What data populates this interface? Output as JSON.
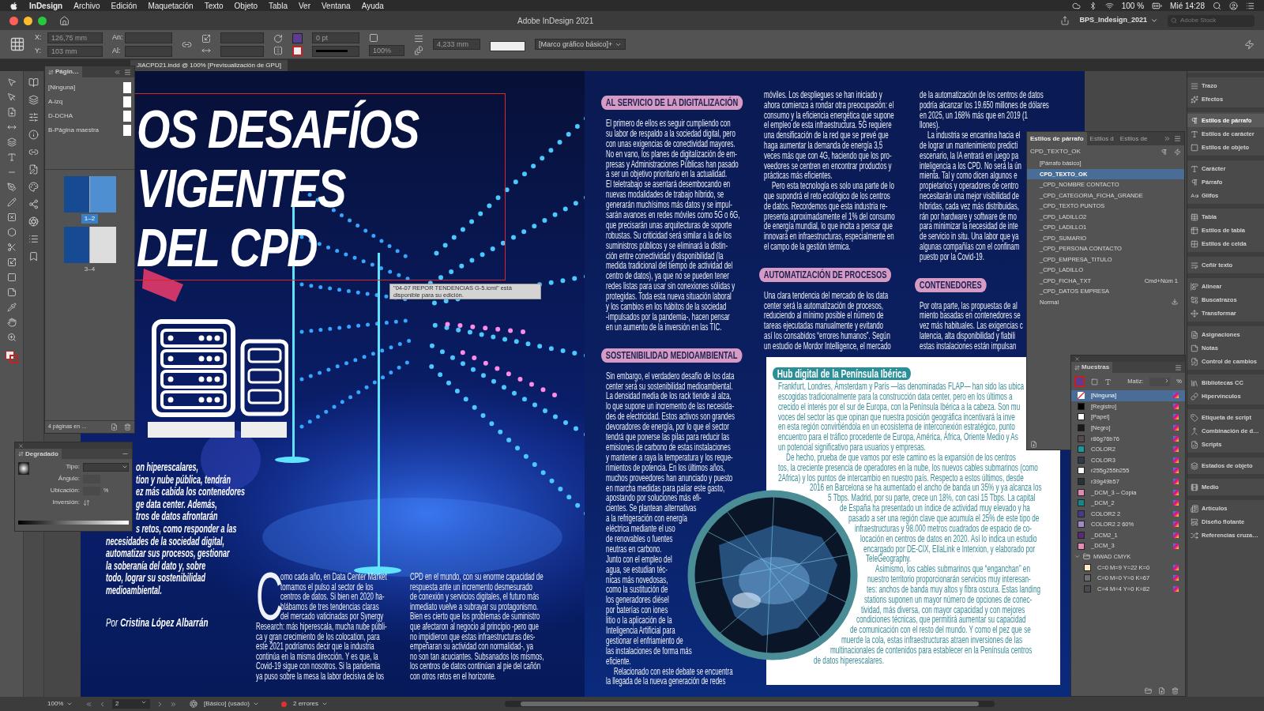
{
  "menu_bar": {
    "app": "InDesign",
    "items": [
      "Archivo",
      "Edición",
      "Maquetación",
      "Texto",
      "Objeto",
      "Tabla",
      "Ver",
      "Ventana",
      "Ayuda"
    ],
    "battery": "100 %",
    "clock": "Mié 14:28"
  },
  "title_bar": {
    "title": "Adobe InDesign 2021",
    "workspace": "BPS_Indesign_2021",
    "stock_search": {
      "placeholder": "Adobe Stock"
    }
  },
  "control_bar": {
    "x_label": "X:",
    "x": "126,75 mm",
    "y_label": "Y:",
    "y": "103 mm",
    "width_label": "An:",
    "height_label": "Al:",
    "stroke_weight": "0 pt",
    "scale": "100%",
    "offset": "4,233 mm",
    "object_style": "[Marco gráfico básico]+"
  },
  "document_tab": {
    "title": "JIACPD21.indd @ 100% [Previsualización de GPU]"
  },
  "pages_panel": {
    "title": "Págin…",
    "masters": [
      {
        "label": "[Ninguna]"
      },
      {
        "label": "A-izq"
      },
      {
        "label": "D-DCHA"
      },
      {
        "label": "B-Página maestra"
      }
    ],
    "spreads": [
      {
        "label": "1–2",
        "selected": true
      },
      {
        "label": "3–4",
        "selected": false
      }
    ],
    "footer": "4 páginas en …"
  },
  "gradient_panel": {
    "title": "Degradado",
    "type_label": "Tipo:",
    "angle_label": "Ángulo:",
    "location_label": "Ubicación:",
    "location_unit": "%",
    "reverse_label": "Inversión:"
  },
  "spread": {
    "title_lines": [
      "OS DESAFÍOS",
      "VIGENTES",
      "DEL CPD"
    ],
    "tooltip": "\"04-07 REPOR TENDENCIAS G-5.icml\" está disponible para su edición.",
    "intro_lines": [
      "on hiperescalares,",
      "tion y nube pública, tendrán",
      "ez más cabida los contenedores",
      "ge data center. Además,",
      "tros de datos afrontarán",
      "s retos, como responder a las",
      "necesidades de la sociedad digital,",
      "automatizar sus procesos, gestionar",
      "la soberanía del dato y, sobre",
      "todo, lograr su sostenibilidad",
      "medioambiental."
    ],
    "byline": "Por **Cristina López Albarrán**",
    "columns": [
      {
        "blocks": [
          {
            "kind": "paragraph",
            "drop_cap": "C",
            "lines": [
              "omo cada año, en Data Center Market",
              "tomamos el pulso al sector de los",
              "centros de datos. Si bien en 2020 ha-",
              "blábamos de tres tendencias claras",
              "del mercado vaticinadas por Synergy",
              "Research: más hiperescala, mucha nube públi-",
              "ca y gran crecimiento de los colocation, para",
              "este 2021 podríamos decir que la industria",
              "continúa en la misma dirección. Y es que, la",
              "Covid-19 sigue con nosotros. Si la pandemia",
              "ya puso sobre la mesa la labor decisiva de los"
            ]
          }
        ]
      },
      {
        "blocks": [
          {
            "kind": "paragraph",
            "lines": [
              "CPD en el mundo, con su enorme capacidad de",
              "respuesta ante un incremento desmesurado",
              "de conexión y servicios digitales, el futuro más",
              "inmediato vuelve a subrayar su protagonismo.",
              "Bien es cierto que los problemas de suministro",
              "que afectaron al negocio al principio -pero que",
              "no impidieron que estas infraestructuras des-",
              "empeñaran su actividad con normalidad-, ya",
              "no son tan acuciantes. Subsanados los mismos,",
              "los centros de datos continúan al pie del cañón",
              "con otros retos en el horizonte."
            ]
          }
        ]
      },
      {
        "blocks": [
          {
            "kind": "heading",
            "text": "AL SERVICIO DE LA DIGITALIZACIÓN"
          },
          {
            "kind": "paragraph",
            "lines": [
              "El primero de ellos es seguir cumpliendo con",
              "su labor de respaldo a la sociedad digital, pero",
              "con unas exigencias de conectividad mayores.",
              "No en vano, los planes de digitalización de em-",
              "presas y Administraciones Públicas han pasado",
              "a ser un objetivo prioritario en la actualidad.",
              "El teletrabajo se asentará desembocando en",
              "nuevas modalidades de trabajo híbrido, se",
              "generarán muchísimos más datos y se impul-",
              "sarán avances en redes móviles como 5G o 6G,",
              "que precisarán unas arquitecturas de soporte",
              "robustas. Su criticidad será similar a la de los",
              "suministros públicos y se eliminará la distin-",
              "ción entre conectividad y disponibilidad (la",
              "medida tradicional del tiempo de actividad del",
              "centro de datos), ya que no se pueden tener",
              "redes listas para usar sin conexiones sólidas y",
              "protegidas. Toda esta nueva situación laboral",
              "y los cambios en los hábitos de la sociedad",
              "-impulsados por la pandemia-, hacen pensar",
              "en un aumento de la inversión en las TIC."
            ]
          },
          {
            "kind": "heading",
            "text": "SOSTENIBILIDAD MEDIOAMBIENTAL"
          },
          {
            "kind": "paragraph",
            "lines": [
              "Sin embargo, el verdadero desafío de los data",
              "center será su sostenibilidad medioambiental.",
              "La densidad media de los rack tiende al alza,",
              "lo que supone un incremento de las necesida-",
              "des de electricidad. Estos activos son grandes",
              "devoradores de energía, por lo que el sector",
              "tendrá que ponerse las pilas para reducir las",
              "emisiones de carbono de estas instalaciones",
              "y mantener a raya la temperatura y los reque-",
              "rimientos de potencia. En los últimos años,",
              "muchos proveedores han anunciado y puesto",
              "en marcha medidas para paliar este gasto,",
              "apostando por soluciones más efi-",
              "cientes. Se plantean alternativas",
              "a la refrigeración con energía",
              "eléctrica mediante el uso",
              "de renovables o fuentes",
              "neutras en carbono.",
              "Junto con el empleo del",
              "agua, se estudian téc-",
              "nicas más novedosas,",
              "como la sustitución de",
              "los generadores diésel",
              "por baterías con iones",
              "litio o la aplicación de la",
              "Inteligencia Artificial para",
              "gestionar el enfriamiento de",
              "las instalaciones de forma más",
              "eficiente."
            ]
          },
          {
            "kind": "paragraph",
            "lines": [
              "Relacionado con este debate se encuentra",
              "la llegada de la nueva generación de redes"
            ]
          }
        ]
      },
      {
        "blocks": [
          {
            "kind": "paragraph",
            "lines": [
              "móviles. Los despliegues se han iniciado y",
              "ahora comienza a rondar otra preocupación: el",
              "consumo y la eficiencia energética que supone",
              "el empleo de esta infraestructura. 5G requiere",
              "una densificación de la red que se prevé que",
              "haga aumentar la demanda de energía 3,5",
              "veces más que con 4G, haciendo que los pro-",
              "veedores se centren en encontrar productos y",
              "prácticas más eficientes."
            ]
          },
          {
            "kind": "paragraph",
            "lines": [
              "Pero esta tecnología es solo una parte de lo",
              "que supondrá el reto ecológico de los centros",
              "de datos. Recordemos que esta industria re-",
              "presenta aproximadamente el 1% del consumo",
              "de energía mundial, lo que incita a pensar que",
              "innovará en infraestructuras, especialmente en",
              "el campo de la gestión térmica."
            ]
          },
          {
            "kind": "heading",
            "text": "AUTOMATIZACIÓN DE PROCESOS"
          },
          {
            "kind": "paragraph",
            "lines": [
              "Una clara tendencia del mercado de los data",
              "center será la automatización de procesos,",
              "reduciendo al mínimo posible el número de",
              "tareas ejecutadas manualmente y evitando",
              "así los consabidos “errores humanos”. Según",
              "un estudio de Mordor Intelligence, el mercado"
            ]
          }
        ]
      },
      {
        "blocks": [
          {
            "kind": "paragraph",
            "lines": [
              "de la automatización de los centros de datos",
              "podría alcanzar los 19.650 millones de dólares",
              "en 2025, un 168% más que en 2019 (1",
              "llones)."
            ]
          },
          {
            "kind": "paragraph",
            "lines": [
              "La industria se encamina hacia el",
              "de lograr un mantenimiento predicti",
              "escenario, la IA entrará en juego pa",
              "inteligencia a los CPD. No será la ún",
              "mienta. Tal y como dicen algunos e",
              "propietarios y operadores de centro",
              "necesitarán una mejor visibilidad de",
              "híbridas, cada vez más distribuidas,",
              "rán por hardware y software de mo",
              "para minimizar la necesidad de inte",
              "de servicio in situ. Una labor que ya",
              "algunas compañías con el confinam",
              "puesto por la Covid-19."
            ]
          },
          {
            "kind": "heading",
            "text": "CONTENEDORES"
          },
          {
            "kind": "paragraph",
            "lines": [
              "Por otra parte, las propuestas de al",
              "miento basadas en contenedores se",
              "vez más habituales. Las exigencias c",
              "latencia, alta disponibilidad y fiabili",
              "estas instalaciones están impulsan"
            ]
          }
        ]
      }
    ],
    "hub": {
      "heading": "Hub digital de la Península Ibérica",
      "paragraphs": [
        {
          "lines": [
            "Frankfurt, Londres, Ámsterdam y París —las denominadas FLAP— han sido las ubica",
            "escogidas tradicionalmente para la construcción data center, pero en los últimos a",
            "crecido el interés por el sur de Europa, con la Península Ibérica a la cabeza. Son mu",
            "voces del sector las que opinan que nuestra posición geográfica incentivará la inve",
            "en esta región convirtiéndola en un ecosistema de interconexión estratégico, punto",
            "encuentro para el tráfico procedente de Europa, América, África, Oriente Medio y As",
            "un potencial significativo para usuarios y empresas."
          ]
        },
        {
          "lines": [
            "De hecho, prueba de que vamos por este camino es la expansión de los centros",
            "tos, la creciente presencia de operadores en la nube, los nuevos cables submarinos (como",
            "2Africa) y los puntos de intercambio en nuestro país. Respecto a estos últimos, desde",
            "2016 en Barcelona se ha aumentado el ancho de banda un 35% y ya alcanza los",
            "5 Tbps. Madrid, por su parte, crece un 18%, con casi 15 Tbps. La capital",
            "de España ha presentado un índice de actividad muy elevado y ha",
            "pasado a ser una región clave que acumula el 25% de este tipo de",
            "infraestructuras y 98.000 metros cuadrados de espacio de co-",
            "locación en centros de datos en 2020. Así lo indica un estudio",
            "encargado por DE-CIX, EllaLink e Interxion, y elaborado por",
            "TeleGeography."
          ]
        },
        {
          "lines": [
            "Asimismo, los cables submarinos que “enganchan” en",
            "nuestro territorio proporcionarán servicios muy interesan-",
            "tes: anchos de banda muy altos y fibra oscura. Estas landing",
            "stations suponen un mayor número de opciones de conec-",
            "tividad, más diversa, con mayor capacidad y con mejores",
            "condiciones técnicas, que permitirá aumentar su capacidad",
            "de comunicación con el resto del mundo. Y como el pez que se",
            "muerde la cola, estas infraestructuras atraen inversiones de las",
            "multinacionales de contenidos para establecer en la Península centros",
            "de datos hiperescalares."
          ]
        }
      ]
    }
  },
  "styles_panel": {
    "tabs": [
      {
        "label": "Estilos de párrafo",
        "selected": true
      },
      {
        "label": "Estilos d",
        "selected": false
      },
      {
        "label": "Estilos de",
        "selected": false
      }
    ],
    "current": "CPD_TEXTO_OK",
    "items": [
      {
        "label": "[Párrafo básico]",
        "selected": false,
        "imported": false
      },
      {
        "label": "CPD_TEXTO_OK",
        "selected": true,
        "imported": false
      },
      {
        "label": "_CPD_NOMBRE CONTACTO",
        "selected": false,
        "imported": false
      },
      {
        "label": "_CPD_CATEGORIA_FICHA_GRANDE",
        "selected": false,
        "imported": false
      },
      {
        "label": "_CPD_TEXTO PUNTOS",
        "selected": false,
        "imported": false
      },
      {
        "label": "_CPD_LADILLO2",
        "selected": false,
        "imported": false
      },
      {
        "label": "_CPD_LADILLO1",
        "selected": false,
        "imported": false
      },
      {
        "label": "_CPD_SUMARIO",
        "selected": false,
        "imported": false
      },
      {
        "label": "_CPD_PERSONA CONTACTO",
        "selected": false,
        "imported": false
      },
      {
        "label": "_CPD_EMPRESA_TITULO",
        "selected": false,
        "imported": false
      },
      {
        "label": "_CPD_LADILLO",
        "selected": false,
        "imported": false
      },
      {
        "label": "_CPD_FICHA_TXT",
        "shortcut": "Cmd+Núm 1",
        "selected": false,
        "imported": false
      },
      {
        "label": "_CPD_DATOS EMPRESA",
        "selected": false,
        "imported": false
      },
      {
        "label": "Normal",
        "selected": false,
        "imported": true
      }
    ]
  },
  "swatches_panel": {
    "title": "Muestras",
    "tint_label": "Matiz:",
    "tint_unit": "%",
    "items": [
      {
        "kind": "none",
        "label": "[Ninguna]",
        "selected": true
      },
      {
        "kind": "swatch",
        "label": "[Registro]",
        "color": "#000000",
        "selected": false
      },
      {
        "kind": "swatch",
        "label": "[Papel]",
        "color": "#ffffff",
        "selected": false
      },
      {
        "kind": "swatch",
        "label": "[Negro]",
        "color": "#1a1a1a",
        "selected": false
      },
      {
        "kind": "swatch",
        "label": "r86g76b76",
        "color": "#564c4c",
        "selected": false
      },
      {
        "kind": "swatch",
        "label": "COLOR2",
        "color": "#1a9aa0",
        "selected": false
      },
      {
        "kind": "swatch",
        "label": "COLOR3",
        "color": "#2e3a4c",
        "selected": false
      },
      {
        "kind": "swatch",
        "label": "r255g255b255",
        "color": "#fefefe",
        "selected": false
      },
      {
        "kind": "swatch",
        "label": "r39g49b57",
        "color": "#273139",
        "selected": false
      },
      {
        "kind": "swatch",
        "label": "_DCM_3 – Copia",
        "color": "#e08ab0",
        "selected": false
      },
      {
        "kind": "swatch",
        "label": "_DCM_2",
        "color": "#14868c",
        "selected": false
      },
      {
        "kind": "swatch",
        "label": "COLOR2 2",
        "color": "#4a3a8c",
        "selected": false
      },
      {
        "kind": "swatch",
        "label": "COLOR2 2 60%",
        "color": "#9e8cc8",
        "selected": false
      },
      {
        "kind": "swatch",
        "label": "_DCM2_1",
        "color": "#5a2a78",
        "selected": false
      },
      {
        "kind": "swatch",
        "label": "_DCM_3",
        "color": "#e28cb2",
        "selected": false
      },
      {
        "kind": "folder",
        "label": "MWAD CMYK",
        "expanded": true,
        "selected": false,
        "children": [
          {
            "kind": "swatch",
            "label": "C=0 M=9 Y=22 K=0",
            "color": "#ffe8c6",
            "selected": false
          },
          {
            "kind": "swatch",
            "label": "C=0 M=0 Y=0 K=67",
            "color": "#6f6f6f",
            "selected": false
          },
          {
            "kind": "swatch",
            "label": "C=4 M=4 Y=0 K=82",
            "color": "#4a4a52",
            "selected": false
          }
        ]
      }
    ]
  },
  "dock": {
    "groups": [
      {
        "items": [
          {
            "label": "Trazo",
            "selected": false
          },
          {
            "label": "Efectos",
            "selected": false
          }
        ]
      },
      {
        "items": [
          {
            "label": "Estilos de párrafo",
            "selected": true
          },
          {
            "label": "Estilos de carácter",
            "selected": false
          },
          {
            "label": "Estilos de objeto",
            "selected": false
          }
        ]
      },
      {
        "items": [
          {
            "label": "Carácter",
            "selected": false
          },
          {
            "label": "Párrafo",
            "selected": false
          },
          {
            "label": "Glifos",
            "selected": false
          }
        ]
      },
      {
        "items": [
          {
            "label": "Tabla",
            "selected": false
          },
          {
            "label": "Estilos de tabla",
            "selected": false
          },
          {
            "label": "Estilos de celda",
            "selected": false
          }
        ]
      },
      {
        "items": [
          {
            "label": "Ceñir texto",
            "selected": false
          }
        ]
      },
      {
        "items": [
          {
            "label": "Alinear",
            "selected": false
          },
          {
            "label": "Buscatrazos",
            "selected": false
          },
          {
            "label": "Transformar",
            "selected": false
          }
        ]
      },
      {
        "items": [
          {
            "label": "Asignaciones",
            "selected": false
          },
          {
            "label": "Notas",
            "selected": false
          },
          {
            "label": "Control de cambios",
            "selected": false
          }
        ]
      },
      {
        "items": [
          {
            "label": "Bibliotecas CC",
            "selected": false
          },
          {
            "label": "Hipervínculos",
            "selected": false
          }
        ]
      },
      {
        "items": [
          {
            "label": "Etiqueta de script",
            "selected": false
          },
          {
            "label": "Combinación de d…",
            "selected": false
          },
          {
            "label": "Scripts",
            "selected": false
          }
        ]
      },
      {
        "items": [
          {
            "label": "Estados de objeto",
            "selected": false
          }
        ]
      },
      {
        "items": [
          {
            "label": "Medio",
            "selected": false
          }
        ]
      },
      {
        "items": [
          {
            "label": "Artículos",
            "selected": false
          },
          {
            "label": "Diseño flotante",
            "selected": false
          },
          {
            "label": "Referencias cruza…",
            "selected": false
          }
        ]
      }
    ]
  },
  "status_bar": {
    "zoom": "100%",
    "page": "2",
    "style": "[Básico] (usado)",
    "errors": "2 errores"
  }
}
